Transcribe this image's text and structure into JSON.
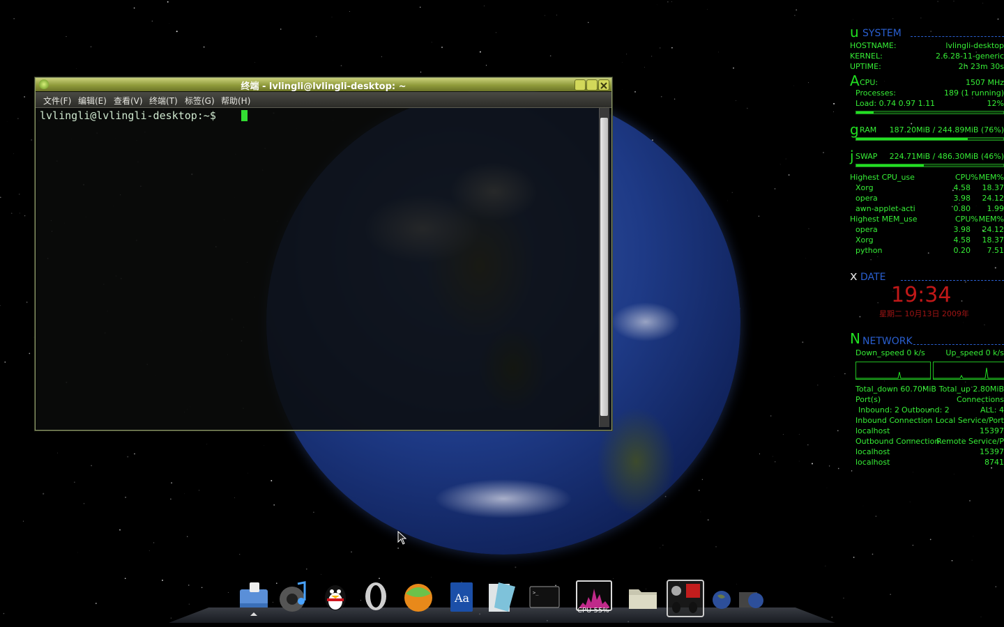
{
  "terminal": {
    "title": "终端 - lvlingli@lvlingli-desktop: ~",
    "menu": [
      "文件(F)",
      "编辑(E)",
      "查看(V)",
      "终端(T)",
      "标签(G)",
      "帮助(H)"
    ],
    "prompt": "lvlingli@lvlingli-desktop:~$"
  },
  "conky": {
    "system": {
      "glyph": "u",
      "title": "SYSTEM",
      "hostname_label": "HOSTNAME:",
      "hostname": "lvlingli-desktop",
      "kernel_label": "KERNEL:",
      "kernel": "2.6.28-11-generic",
      "uptime_label": "UPTIME:",
      "uptime": "2h 23m 30s"
    },
    "cpu": {
      "glyph": "A",
      "label": "CPU:",
      "freq": "1507 MHz",
      "processes_label": "Processes:",
      "processes": "189 (1 running)",
      "load_label": "Load: 0.74 0.97 1.11",
      "load_pct": "12%",
      "bar_fraction": 0.12
    },
    "ram": {
      "glyph": "g",
      "label": "RAM",
      "value": "187.20MiB / 244.89MiB (76%)",
      "bar_fraction": 0.76
    },
    "swap": {
      "glyph": "j",
      "label": "SWAP",
      "value": "224.71MiB / 486.30MiB (46%)",
      "bar_fraction": 0.46
    },
    "top_cpu": {
      "title": "Highest CPU_use",
      "col1": "CPU%",
      "col2": "MEM%",
      "rows": [
        {
          "name": "Xorg",
          "cpu": "4.58",
          "mem": "18.37"
        },
        {
          "name": "opera",
          "cpu": "3.98",
          "mem": "24.12"
        },
        {
          "name": "awn-applet-acti",
          "cpu": "0.80",
          "mem": "1.99"
        }
      ]
    },
    "top_mem": {
      "title": "Highest MEM_use",
      "col1": "CPU%",
      "col2": "MEM%",
      "rows": [
        {
          "name": "opera",
          "cpu": "3.98",
          "mem": "24.12"
        },
        {
          "name": "Xorg",
          "cpu": "4.58",
          "mem": "18.37"
        },
        {
          "name": "python",
          "cpu": "0.20",
          "mem": "7.51"
        }
      ]
    },
    "date": {
      "glyph": "x",
      "title": "DATE",
      "time": "19:34",
      "date": "星期二 10月13日 2009年"
    },
    "network": {
      "glyph": "N",
      "title": "NETWORK",
      "down_speed": "Down_speed 0 k/s",
      "up_speed": "Up_speed 0 k/s",
      "total_down": "Total_down 60.70MiB",
      "total_up": "Total_up 2.80MiB",
      "ports_label": "Port(s)",
      "connections_label": "Connections",
      "inbound_count": "Inbound: 2",
      "outbound_count": "Outbound: 2",
      "all_count": "ALL: 4",
      "inbound_header": "Inbound Connection",
      "inbound_header_right": "Local Service/Port",
      "inbound_rows": [
        {
          "host": "localhost",
          "port": "15397"
        }
      ],
      "outbound_header": "Outbound Connection",
      "outbound_header_right": "Remote Service/P",
      "outbound_rows": [
        {
          "host": "localhost",
          "port": "15397"
        },
        {
          "host": "localhost",
          "port": "8741"
        }
      ]
    }
  },
  "dock": {
    "items": [
      "file-manager-icon",
      "music-player-icon",
      "qq-penguin-icon",
      "opera-icon",
      "mail-icon",
      "dictionary-icon",
      "text-editor-icon",
      "terminal-icon",
      "cpu-monitor-icon",
      "folder-icon",
      "tray-applet-icon",
      "globe-icon",
      "globe-screen-icon"
    ],
    "cpu_label": "CPU 55%",
    "cpu_fraction": 0.55
  },
  "colors": {
    "conky_green": "#36ee36",
    "conky_blue": "#2a5fd0",
    "clock_red": "#c01818",
    "terminal_cursor": "#33dd33"
  }
}
